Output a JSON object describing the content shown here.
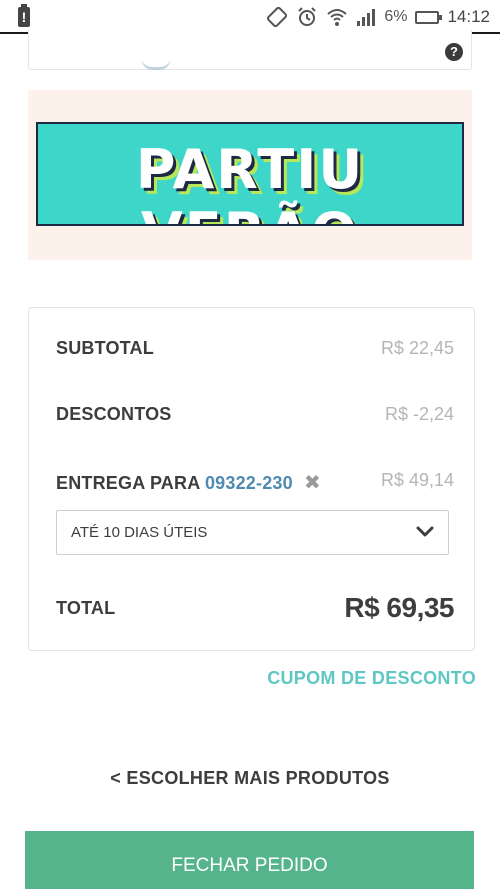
{
  "status_bar": {
    "battery_alert": "!",
    "battery_percent": "6%",
    "time": "14:12",
    "icons": [
      "screen-rotate-icon",
      "alarm-icon",
      "wifi-icon",
      "signal-icon",
      "battery-icon"
    ]
  },
  "top_card": {
    "help_icon": "?"
  },
  "banner": {
    "text": "PARTIU VERÃO"
  },
  "summary": {
    "subtotal_label": "SUBTOTAL",
    "subtotal_value": "R$ 22,45",
    "discount_label": "DESCONTOS",
    "discount_value": "R$ -2,24",
    "delivery_label": "ENTREGA PARA",
    "delivery_zip": "09322-230",
    "delivery_remove": "✖",
    "delivery_value": "R$ 49,14",
    "shipping_option": "ATÉ 10 DIAS ÚTEIS",
    "total_label": "TOTAL",
    "total_value": "R$ 69,35"
  },
  "actions": {
    "coupon_link": "CUPOM DE DESCONTO",
    "continue_shopping": "< ESCOLHER MAIS PRODUTOS",
    "checkout_button": "FECHAR PEDIDO"
  },
  "colors": {
    "accent_teal": "#5fc7c3",
    "checkout_green": "#56b48b",
    "zip_blue": "#4f8ab0"
  }
}
